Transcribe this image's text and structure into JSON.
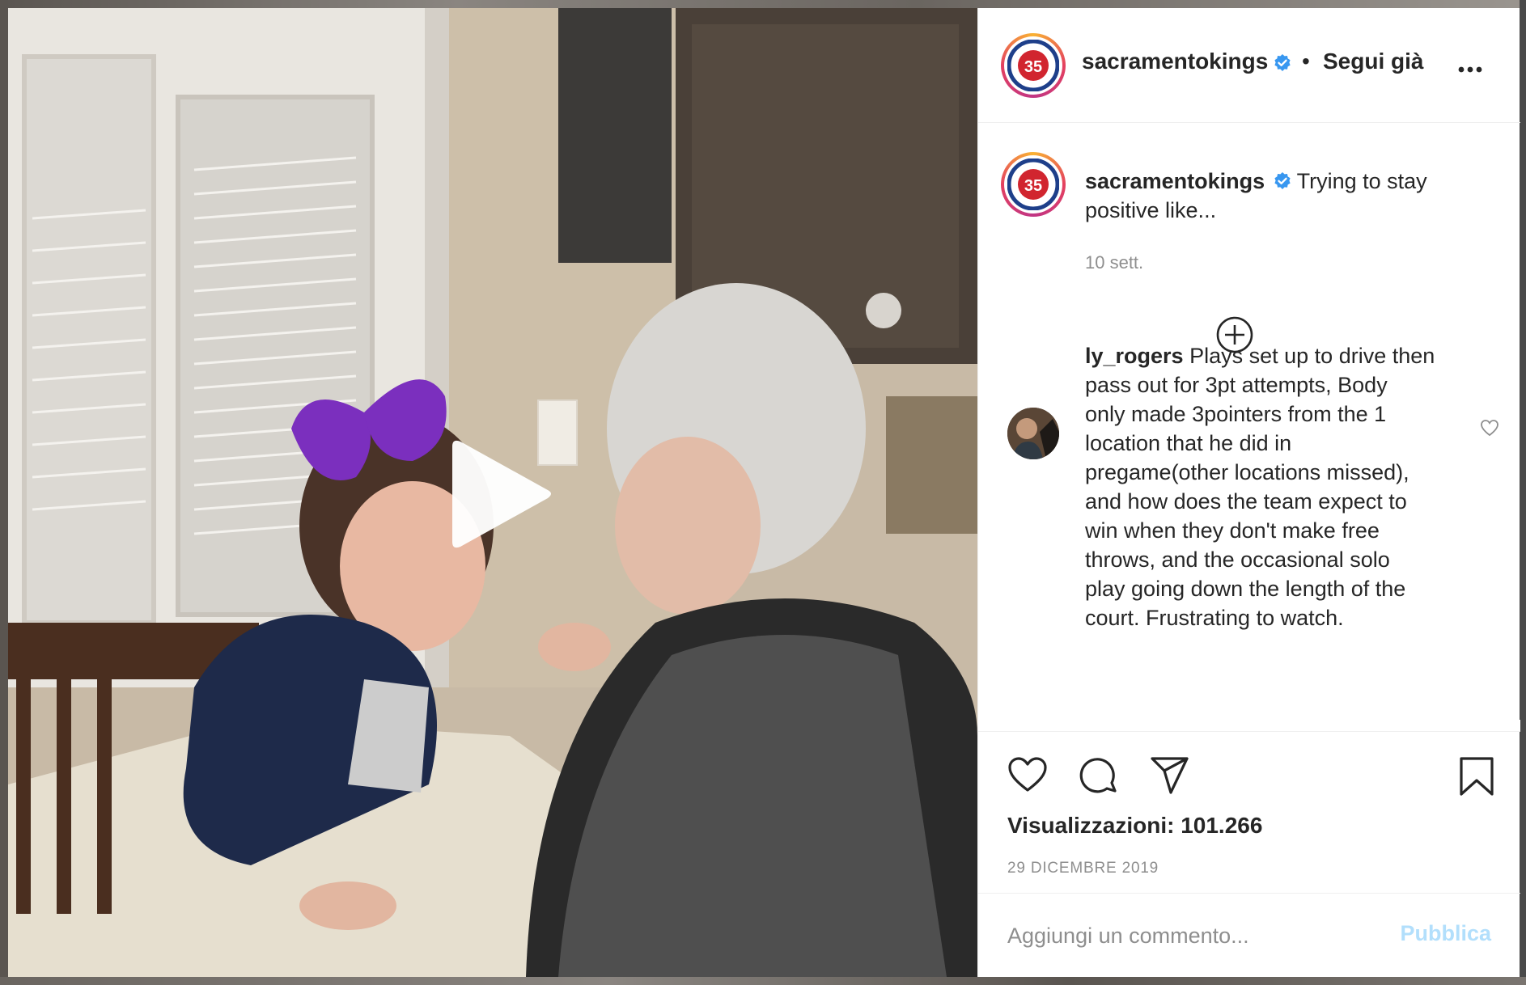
{
  "account": {
    "username": "sacramentokings",
    "follow_label": "Segui già",
    "separator": "•",
    "logo_number": "35"
  },
  "caption": {
    "username": "sacramentokings",
    "text": "Trying to stay",
    "text_line2": "positive like...",
    "time": "10 sett."
  },
  "comments": [
    {
      "username": "ly_rogers",
      "lines": [
        "Plays set up to drive then",
        "pass out for 3pt attempts, Body",
        "only made 3pointers from the 1",
        "location that he did in",
        "pregame(other locations missed),",
        "and how does the team expect to",
        "win when they don't make free",
        "throws, and the occasional solo",
        "play going down the length of the",
        "court. Frustrating to watch."
      ]
    }
  ],
  "stats": {
    "views_label": "Visualizzazioni: 101.266",
    "date": "29 DICEMBRE 2019"
  },
  "comment_box": {
    "placeholder": "Aggiungi un commento...",
    "publish_label": "Pubblica"
  },
  "colors": {
    "verified": "#3897f0",
    "publish_disabled": "#b2dffc",
    "bow": "#7b2fbe"
  },
  "icons": {
    "verified": "verified-badge-icon",
    "more": "more-options-icon",
    "load_more": "add-circle-icon",
    "like": "heart-icon",
    "comment": "comment-icon",
    "share": "share-icon",
    "save": "bookmark-icon",
    "play": "play-icon"
  }
}
